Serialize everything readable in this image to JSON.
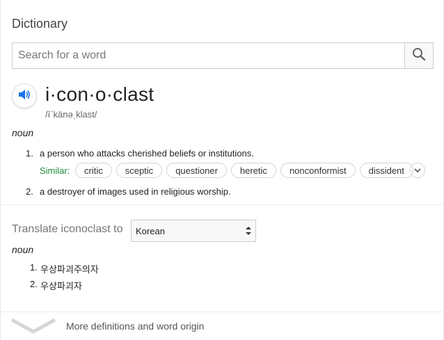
{
  "panel": {
    "title": "Dictionary"
  },
  "search": {
    "placeholder": "Search for a word",
    "value": ""
  },
  "entry": {
    "headword": "i·con·o·clast",
    "phonetic": "/īˈkänəˌklast/",
    "part_of_speech": "noun",
    "definitions": [
      {
        "number": "1.",
        "text": "a person who attacks cherished beliefs or institutions.",
        "similar_label": "Similar:",
        "similar": [
          "critic",
          "sceptic",
          "questioner",
          "heretic",
          "nonconformist",
          "dissident"
        ]
      },
      {
        "number": "2.",
        "text": "a destroyer of images used in religious worship."
      }
    ]
  },
  "translate": {
    "label": "Translate iconoclast to",
    "selected_language": "Korean",
    "part_of_speech": "noun",
    "results": [
      {
        "number": "1.",
        "text": "우상파괴주의자"
      },
      {
        "number": "2.",
        "text": "우상파괴자"
      }
    ]
  },
  "footer": {
    "more_label": "More definitions and word origin"
  },
  "colors": {
    "accent_blue": "#1a73e8",
    "similar_green": "#1e8a3a",
    "border": "#cccccc"
  }
}
